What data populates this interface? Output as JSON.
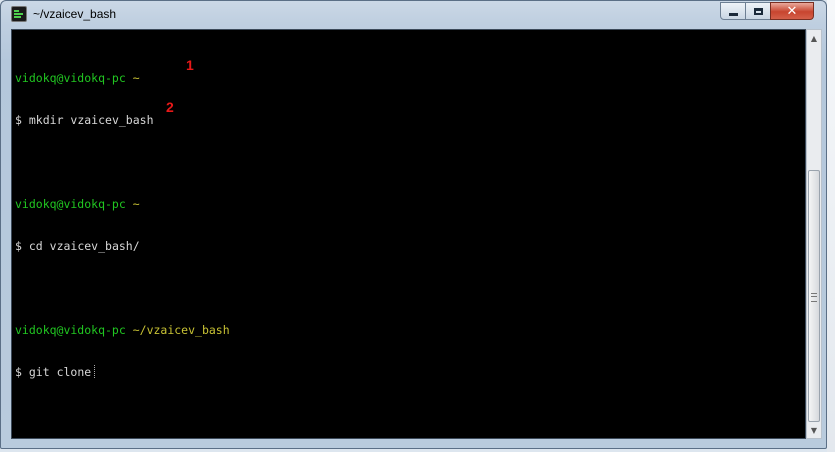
{
  "window": {
    "title": "~/vzaicev_bash",
    "icon": "terminal-icon"
  },
  "controls": {
    "minimize_icon": "minimize-icon",
    "maximize_icon": "maximize-icon",
    "close_icon": "close-icon",
    "close_glyph": "✕"
  },
  "terminal": {
    "lines": [
      {
        "user": "vidokq@vidokq-pc",
        "path": "~"
      },
      {
        "prompt": "$",
        "command": "mkdir vzaicev_bash"
      },
      {
        "blank": true
      },
      {
        "user": "vidokq@vidokq-pc",
        "path": "~"
      },
      {
        "prompt": "$",
        "command": "cd vzaicev_bash/"
      },
      {
        "blank": true
      },
      {
        "user": "vidokq@vidokq-pc",
        "path": "~/vzaicev_bash"
      },
      {
        "prompt": "$",
        "command": "git clone"
      }
    ],
    "annotations": [
      "1",
      "2"
    ]
  },
  "colors": {
    "background": "#000000",
    "user_host": "#21c621",
    "path": "#c8c234",
    "text": "#d8d8d8",
    "annotation": "#e81818"
  }
}
